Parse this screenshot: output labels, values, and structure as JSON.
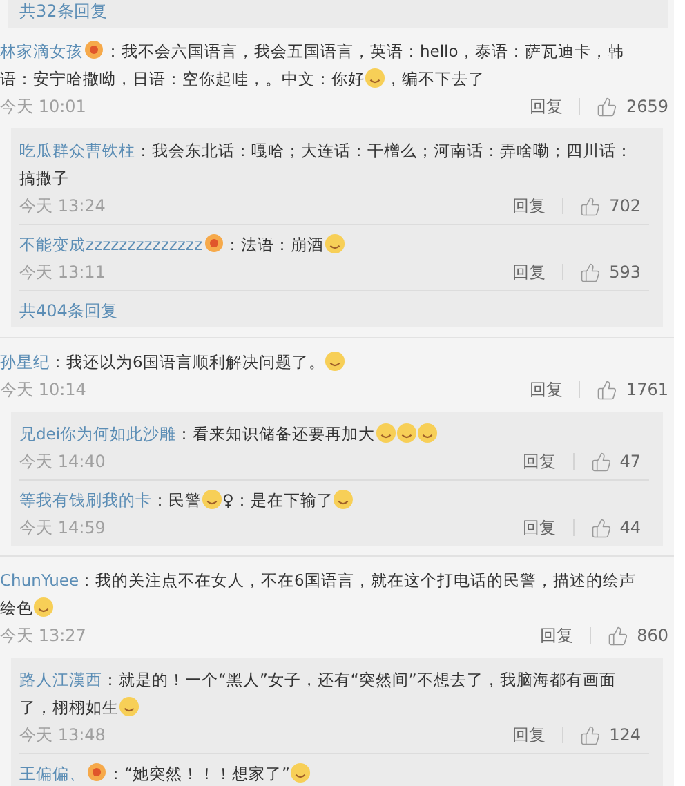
{
  "top_reply_count": "共32条回复",
  "comments": [
    {
      "user": "林家滴女孩",
      "badge": true,
      "body": [
        {
          "kind": "text",
          "text": "：我不会六国语言，我会五国语言，英语：hello，泰语：萨瓦迪卡，韩"
        },
        {
          "kind": "break"
        },
        {
          "kind": "text",
          "text": "语：安宁哈撒呦，日语：空你起哇，。中文：你好"
        },
        {
          "kind": "emoji"
        },
        {
          "kind": "text",
          "text": "，编不下去了"
        }
      ],
      "time": "今天 10:01",
      "reply": "回复",
      "likes": "2659",
      "more": "共404条回复",
      "replies": [
        {
          "user": "吃瓜群众曹铁柱",
          "badge": false,
          "body": [
            {
              "kind": "text",
              "text": "：我会东北话：嘎哈；大连话：干橧么；河南话：弄啥嘞；四川话："
            },
            {
              "kind": "break"
            },
            {
              "kind": "text",
              "text": "搞撒子"
            }
          ],
          "time": "今天 13:24",
          "reply": "回复",
          "likes": "702"
        },
        {
          "user": "不能变成zzzzzzzzzzzzzz",
          "badge": true,
          "body": [
            {
              "kind": "text",
              "text": "：法语：崩酒"
            },
            {
              "kind": "emoji"
            }
          ],
          "time": "今天 13:11",
          "reply": "回复",
          "likes": "593"
        }
      ]
    },
    {
      "user": "孙星纪",
      "badge": false,
      "body": [
        {
          "kind": "text",
          "text": "：我还以为6国语言顺利解决问题了。"
        },
        {
          "kind": "emoji"
        }
      ],
      "time": "今天 10:14",
      "reply": "回复",
      "likes": "1761",
      "replies": [
        {
          "user": "兄dei你为何如此沙雕",
          "badge": false,
          "body": [
            {
              "kind": "text",
              "text": "：看来知识储备还要再加大"
            },
            {
              "kind": "emoji"
            },
            {
              "kind": "emoji"
            },
            {
              "kind": "emoji"
            }
          ],
          "time": "今天 14:40",
          "reply": "回复",
          "likes": "47"
        },
        {
          "user": "等我有钱刷我的卡",
          "badge": false,
          "body": [
            {
              "kind": "text",
              "text": "：民警"
            },
            {
              "kind": "emoji"
            },
            {
              "kind": "text",
              "text": "♀：是在下输了"
            },
            {
              "kind": "emoji"
            }
          ],
          "time": "今天 14:59",
          "reply": "回复",
          "likes": "44"
        }
      ]
    },
    {
      "user": "ChunYuee",
      "badge": false,
      "body": [
        {
          "kind": "text",
          "text": "：我的关注点不在女人，不在6国语言，就在这个打电话的民警，描述的绘声"
        },
        {
          "kind": "break"
        },
        {
          "kind": "text",
          "text": "绘色"
        },
        {
          "kind": "emoji"
        }
      ],
      "time": "今天 13:27",
      "reply": "回复",
      "likes": "860",
      "replies": [
        {
          "user": "路人江漢西",
          "badge": false,
          "body": [
            {
              "kind": "text",
              "text": "：就是的！一个“黑人”女子，还有“突然间”不想去了，我脑海都有画面"
            },
            {
              "kind": "break"
            },
            {
              "kind": "text",
              "text": "了，栩栩如生"
            },
            {
              "kind": "emoji"
            }
          ],
          "time": "今天 13:48",
          "reply": "回复",
          "likes": "124"
        },
        {
          "user": "王偏偏、",
          "badge": true,
          "body": [
            {
              "kind": "text",
              "text": "：“她突然！！！想家了”"
            },
            {
              "kind": "emoji"
            }
          ]
        }
      ]
    }
  ]
}
